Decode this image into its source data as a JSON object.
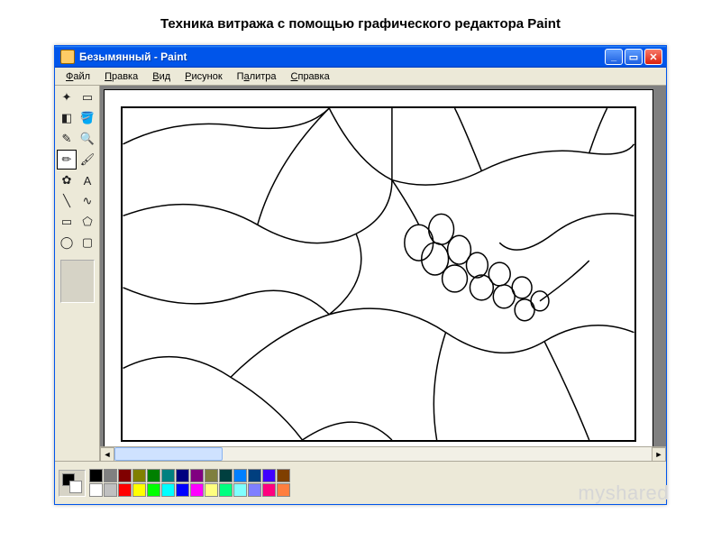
{
  "slide": {
    "title": "Техника витража с помощью графического редактора Paint"
  },
  "window": {
    "title": "Безымянный - Paint"
  },
  "menu": {
    "items": [
      {
        "label": "Файл",
        "hotkey_index": 0
      },
      {
        "label": "Правка",
        "hotkey_index": 0
      },
      {
        "label": "Вид",
        "hotkey_index": 0
      },
      {
        "label": "Рисунок",
        "hotkey_index": 0
      },
      {
        "label": "Палитра",
        "hotkey_index": 1
      },
      {
        "label": "Справка",
        "hotkey_index": 0
      }
    ]
  },
  "tools": [
    {
      "name": "free-select",
      "glyph": "✦"
    },
    {
      "name": "rect-select",
      "glyph": "▭"
    },
    {
      "name": "eraser",
      "glyph": "◧"
    },
    {
      "name": "fill",
      "glyph": "🪣"
    },
    {
      "name": "eyedropper",
      "glyph": "✎"
    },
    {
      "name": "magnifier",
      "glyph": "🔍"
    },
    {
      "name": "pencil",
      "glyph": "✏",
      "selected": true
    },
    {
      "name": "brush",
      "glyph": "🖌"
    },
    {
      "name": "airbrush",
      "glyph": "✿"
    },
    {
      "name": "text",
      "glyph": "A"
    },
    {
      "name": "line",
      "glyph": "╲"
    },
    {
      "name": "curve",
      "glyph": "∿"
    },
    {
      "name": "rectangle",
      "glyph": "▭"
    },
    {
      "name": "polygon",
      "glyph": "⬠"
    },
    {
      "name": "ellipse",
      "glyph": "◯"
    },
    {
      "name": "rounded-rect",
      "glyph": "▢"
    }
  ],
  "colors": {
    "foreground": "#000000",
    "background": "#ffffff",
    "palette": [
      "#000000",
      "#808080",
      "#800000",
      "#808000",
      "#008000",
      "#008080",
      "#000080",
      "#800080",
      "#7f7f3f",
      "#003f3f",
      "#007fff",
      "#003f7f",
      "#3f00ff",
      "#7f3f00",
      "#ffffff",
      "#c0c0c0",
      "#ff0000",
      "#ffff00",
      "#00ff00",
      "#00ffff",
      "#0000ff",
      "#ff00ff",
      "#ffff7f",
      "#00ff7f",
      "#7fffff",
      "#7f7fff",
      "#ff007f",
      "#ff7f3f"
    ]
  },
  "watermark": "myshared"
}
